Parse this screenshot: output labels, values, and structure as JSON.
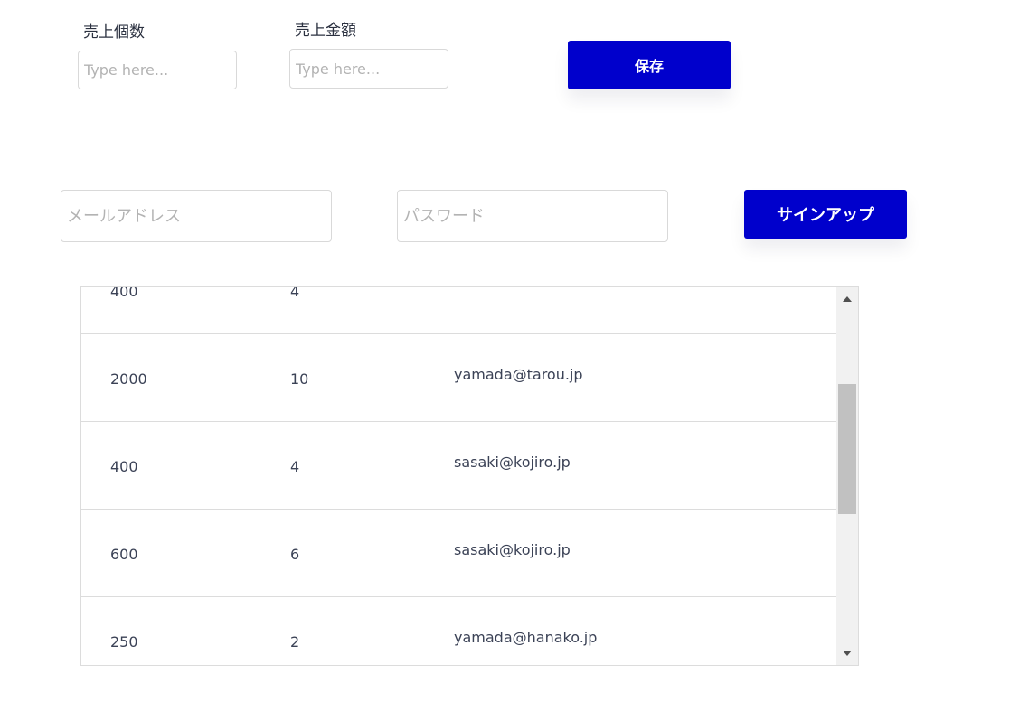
{
  "sales_form": {
    "quantity_label": "売上個数",
    "quantity_placeholder": "Type here...",
    "amount_label": "売上金額",
    "amount_placeholder": "Type here...",
    "save_label": "保存"
  },
  "signup_form": {
    "email_placeholder": "メールアドレス",
    "password_placeholder": "パスワード",
    "signup_label": "サインアップ"
  },
  "table": {
    "rows": [
      {
        "amount": "400",
        "quantity": "4",
        "email": ""
      },
      {
        "amount": "2000",
        "quantity": "10",
        "email": "yamada@tarou.jp"
      },
      {
        "amount": "400",
        "quantity": "4",
        "email": "sasaki@kojiro.jp"
      },
      {
        "amount": "600",
        "quantity": "6",
        "email": "sasaki@kojiro.jp"
      },
      {
        "amount": "250",
        "quantity": "2",
        "email": "yamada@hanako.jp"
      }
    ]
  },
  "colors": {
    "accent": "#0000cc",
    "text": "#2b3140",
    "border": "#d9d9d9"
  }
}
